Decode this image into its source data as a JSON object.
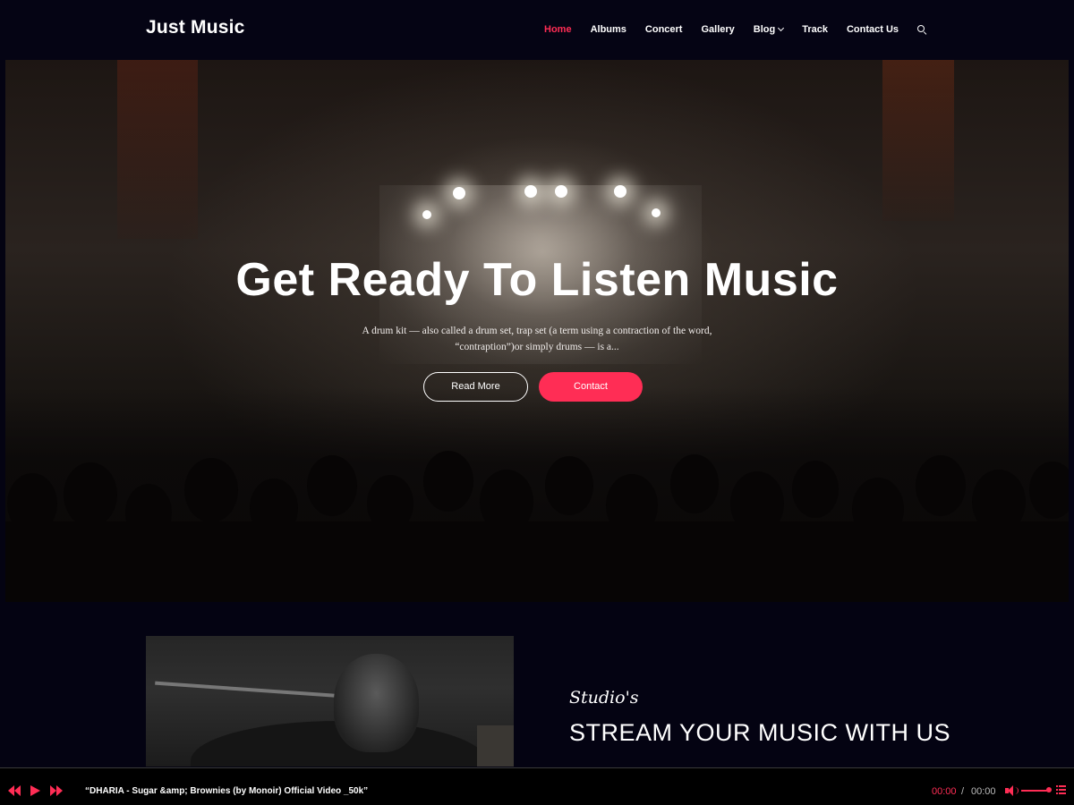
{
  "header": {
    "logo": "Just Music",
    "nav": [
      {
        "label": "Home",
        "active": true
      },
      {
        "label": "Albums"
      },
      {
        "label": "Concert"
      },
      {
        "label": "Gallery"
      },
      {
        "label": "Blog",
        "has_dropdown": true
      },
      {
        "label": "Track"
      },
      {
        "label": "Contact Us"
      }
    ],
    "search_icon": "search-icon"
  },
  "hero": {
    "title": "Get Ready To Listen Music",
    "description_line1": "A drum kit — also called a drum set, trap set (a term using a contraction of the word,",
    "description_line2": "“contraption”)or simply drums — is a...",
    "read_more_label": "Read More",
    "contact_label": "Contact"
  },
  "section": {
    "script_label": "Studio's",
    "title": "STREAM YOUR MUSIC WITH US"
  },
  "player": {
    "track_title": "“DHARIA - Sugar &amp; Brownies (by Monoir) Official Video _50k”",
    "current_time": "00:00",
    "separator": "/",
    "duration": "00:00",
    "icons": [
      "prev-icon",
      "play-icon",
      "next-icon",
      "volume-icon",
      "playlist-icon"
    ]
  },
  "colors": {
    "accent": "#ff2d55",
    "background": "#040312"
  }
}
